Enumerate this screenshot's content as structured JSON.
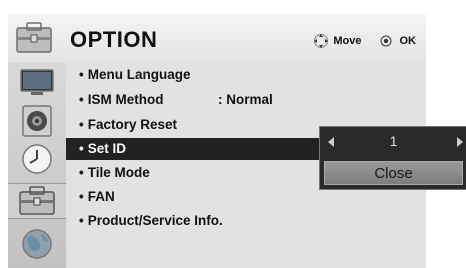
{
  "header": {
    "title": "OPTION",
    "move_label": "Move",
    "ok_label": "OK",
    "icon": "option-toolbox-icon"
  },
  "sidebar": {
    "icons": [
      "picture-tv-icon",
      "audio-speaker-icon",
      "time-clock-icon",
      "option-toolbox-icon",
      "network-globe-icon"
    ],
    "active_index": 3
  },
  "menu": {
    "items": [
      {
        "label": "Menu Language",
        "value": ""
      },
      {
        "label": "ISM Method",
        "value": ": Normal"
      },
      {
        "label": "Factory Reset",
        "value": ""
      },
      {
        "label": "Set ID",
        "value": ""
      },
      {
        "label": "Tile Mode",
        "value": ""
      },
      {
        "label": "FAN",
        "value": ""
      },
      {
        "label": "Product/Service Info.",
        "value": ""
      }
    ],
    "selected_index": 3,
    "bullet": "•"
  },
  "popup": {
    "value": "1",
    "close_label": "Close"
  },
  "colors": {
    "selected_bg": "#222222",
    "menu_bg": "#e2e2e2",
    "popup_bg": "#2a2a2a"
  }
}
